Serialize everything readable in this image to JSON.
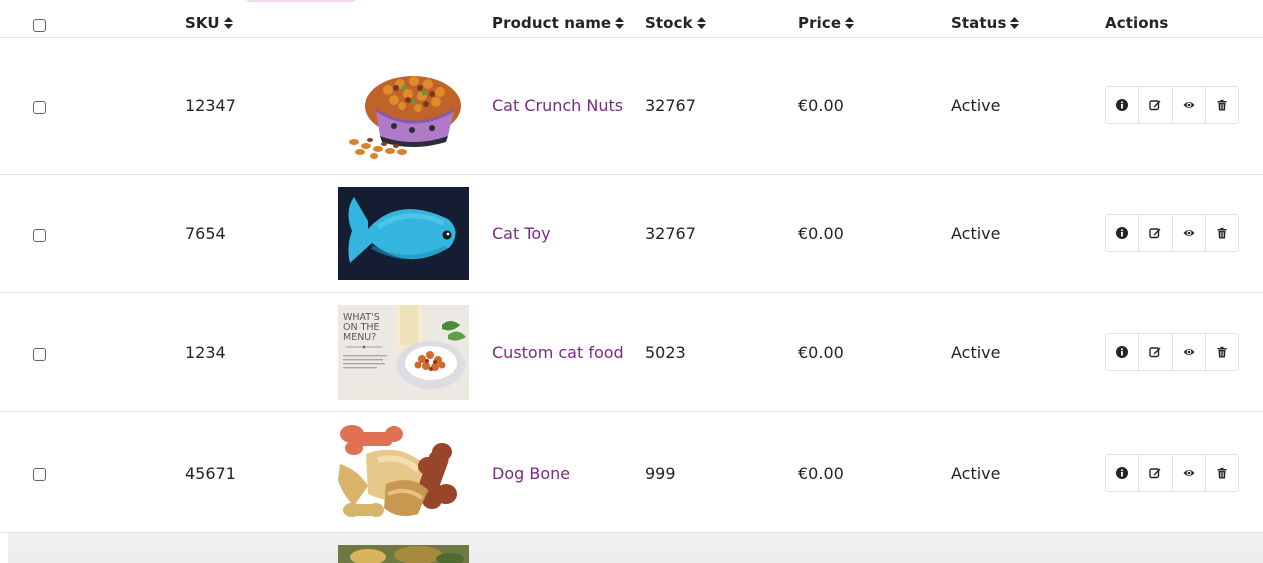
{
  "table": {
    "columns": {
      "sku": "SKU",
      "product_name": "Product name",
      "stock": "Stock",
      "price": "Price",
      "status": "Status",
      "actions": "Actions"
    },
    "rows": [
      {
        "sku": "12347",
        "name": "Cat Crunch Nuts",
        "stock": "32767",
        "price": "€0.00",
        "status": "Active",
        "image": "cat-food-bowl-image"
      },
      {
        "sku": "7654",
        "name": "Cat Toy",
        "stock": "32767",
        "price": "€0.00",
        "status": "Active",
        "image": "blue-fish-toy-image"
      },
      {
        "sku": "1234",
        "name": "Custom cat food",
        "stock": "5023",
        "price": "€0.00",
        "status": "Active",
        "image": "menu-card-image"
      },
      {
        "sku": "45671",
        "name": "Dog Bone",
        "stock": "999",
        "price": "€0.00",
        "status": "Active",
        "image": "dog-treats-image"
      }
    ],
    "row_actions": [
      "info-icon",
      "edit-icon",
      "view-icon",
      "delete-icon"
    ],
    "menu_card_text": [
      "WHAT'S",
      "ON THE",
      "MENU?"
    ]
  },
  "colors": {
    "link": "#7b2a85",
    "border": "#dee2e6",
    "text": "#212529"
  }
}
